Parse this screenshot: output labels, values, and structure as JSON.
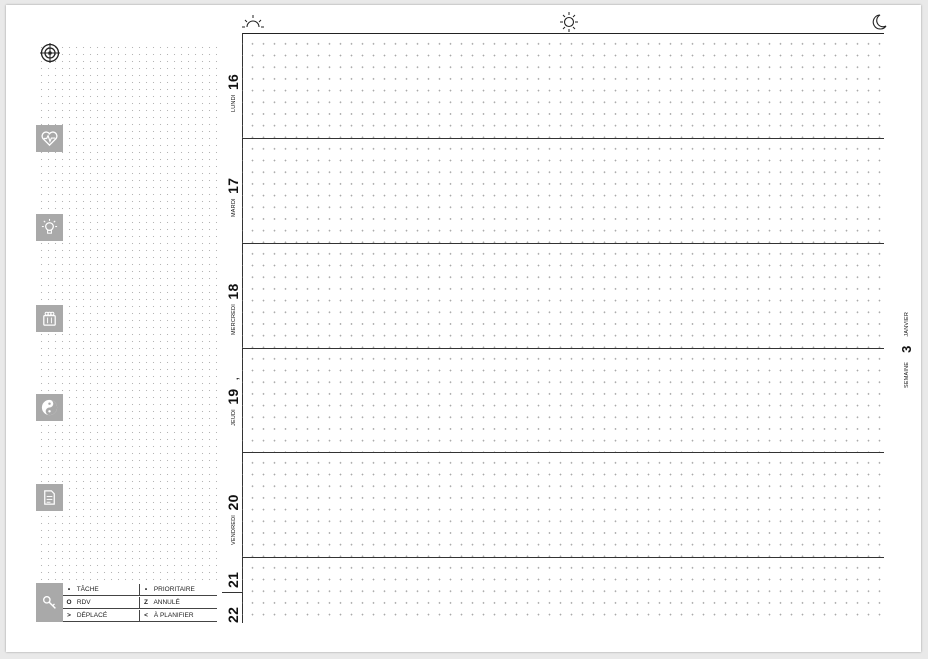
{
  "header_icons": [
    "sunrise-icon",
    "sun-icon",
    "moon-icon"
  ],
  "left_icons": [
    "target-icon",
    "heart-pulse-icon",
    "lightbulb-icon",
    "meal-icon",
    "yin-yang-icon",
    "note-icon"
  ],
  "days": [
    {
      "num": "16",
      "name": "LUNDI"
    },
    {
      "num": "17",
      "name": "MARDI"
    },
    {
      "num": "18",
      "name": "MERCREDI"
    },
    {
      "num": "19",
      "name": "JEUDI",
      "mark": ","
    },
    {
      "num": "20",
      "name": "VENDREDI"
    },
    {
      "num": "21",
      "name": ""
    },
    {
      "num": "22",
      "name": ""
    }
  ],
  "week": {
    "label": "SEMAINE",
    "number": "3",
    "month": "JANVIER"
  },
  "legend": {
    "key_icon": "key-icon",
    "items": [
      {
        "symbol": "•",
        "label": "TÂCHE"
      },
      {
        "symbol": "•",
        "label": "PRIORITAIRE"
      },
      {
        "symbol": "O",
        "label": "RDV"
      },
      {
        "symbol": "Z",
        "label": "ANNULÉ"
      },
      {
        "symbol": ">",
        "label": "DÉPLACÉ"
      },
      {
        "symbol": "<",
        "label": "À PLANIFIER"
      }
    ]
  }
}
